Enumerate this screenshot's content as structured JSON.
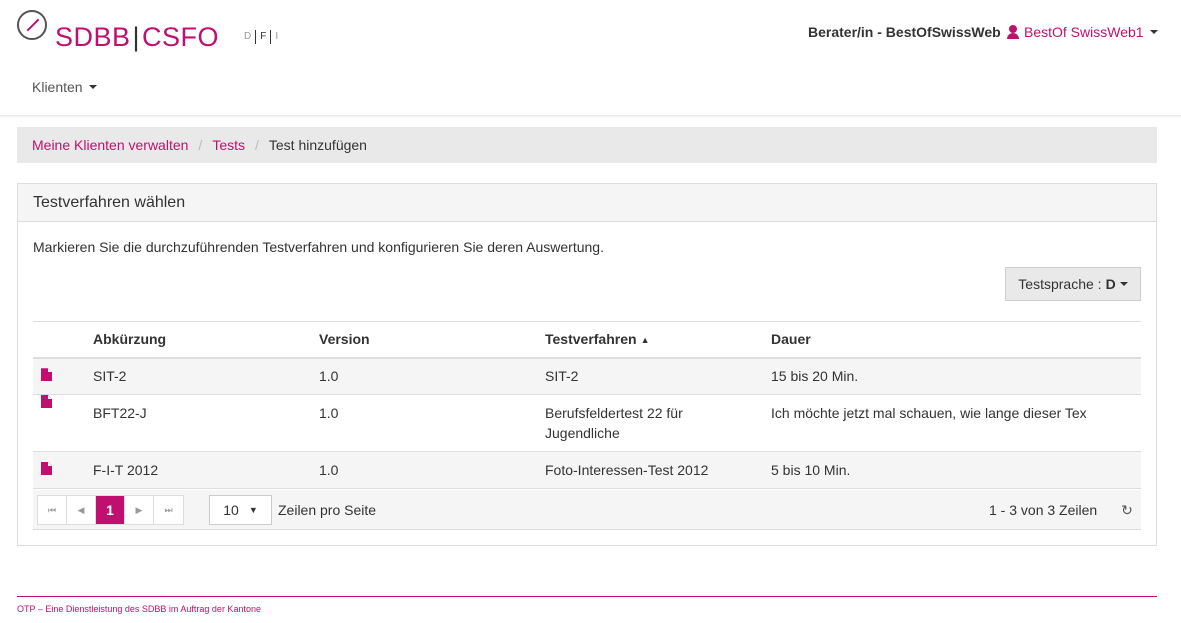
{
  "brand": {
    "left": "SDBB",
    "separator": "|",
    "right": "CSFO"
  },
  "languages": [
    "D",
    "F",
    "I"
  ],
  "header": {
    "role": "Berater/in - BestOfSwissWeb",
    "user": "BestOf SwissWeb1"
  },
  "nav": {
    "clients": "Klienten"
  },
  "breadcrumb": {
    "item1": "Meine Klienten verwalten",
    "item2": "Tests",
    "current": "Test hinzufügen"
  },
  "panel": {
    "title": "Testverfahren wählen",
    "description": "Markieren Sie die durchzuführenden Testverfahren und konfigurieren Sie deren Auswertung.",
    "language_button_label": "Testsprache :",
    "language_button_value": "D"
  },
  "table": {
    "headers": {
      "abbr": "Abkürzung",
      "version": "Version",
      "procedure": "Testverfahren",
      "sort_indicator": "▲",
      "duration": "Dauer"
    },
    "rows": [
      {
        "abbr": "SIT-2",
        "version": "1.0",
        "procedure": "SIT-2",
        "duration": "15 bis 20 Min."
      },
      {
        "abbr": "BFT22-J",
        "version": "1.0",
        "procedure": "Berufsfeldertest 22 für Jugendliche",
        "duration": "Ich möchte jetzt mal schauen, wie lange dieser Tex"
      },
      {
        "abbr": "F-I-T 2012",
        "version": "1.0",
        "procedure": "Foto-Interessen-Test 2012",
        "duration": "5 bis 10 Min."
      }
    ]
  },
  "pager": {
    "first": "⏮",
    "prev": "◀",
    "page": "1",
    "next": "▶",
    "last": "⏭",
    "page_size": "10",
    "rows_label": "Zeilen pro Seite",
    "count": "1 - 3 von 3 Zeilen",
    "refresh": "↻"
  },
  "footer": {
    "text": "OTP – Eine Dienstleistung des SDBB im Auftrag der Kantone"
  },
  "colors": {
    "accent": "#c0106f"
  }
}
